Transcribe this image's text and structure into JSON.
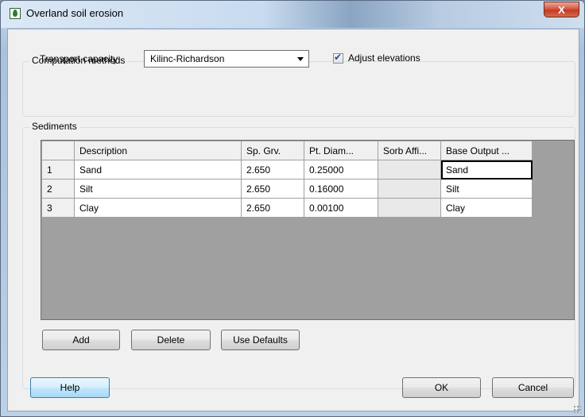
{
  "window": {
    "title": "Overland soil erosion",
    "close_glyph": "X"
  },
  "computation": {
    "group_label": "Computation methods",
    "transport_label": "Transport capacity:",
    "transport_value": "Kilinc-Richardson",
    "adjust_label": "Adjust elevations",
    "adjust_checked": true
  },
  "sediments": {
    "group_label": "Sediments",
    "columns": [
      "Description",
      "Sp. Grv.",
      "Pt. Diam...",
      "Sorb Affi...",
      "Base Output ..."
    ],
    "rows": [
      {
        "num": "1",
        "description": "Sand",
        "sp_grv": "2.650",
        "pt_diam": "0.25000",
        "sorb_affi": "",
        "base_output": "Sand"
      },
      {
        "num": "2",
        "description": "Silt",
        "sp_grv": "2.650",
        "pt_diam": "0.16000",
        "sorb_affi": "",
        "base_output": "Silt"
      },
      {
        "num": "3",
        "description": "Clay",
        "sp_grv": "2.650",
        "pt_diam": "0.00100",
        "sorb_affi": "",
        "base_output": "Clay"
      }
    ],
    "add_label": "Add",
    "delete_label": "Delete",
    "defaults_label": "Use Defaults"
  },
  "footer": {
    "help_label": "Help",
    "ok_label": "OK",
    "cancel_label": "Cancel"
  },
  "icons": {
    "app": "water-drop-icon",
    "close": "close-icon",
    "dropdown": "chevron-down-icon",
    "check": "checkmark-icon",
    "grip": "resize-grip-icon"
  }
}
